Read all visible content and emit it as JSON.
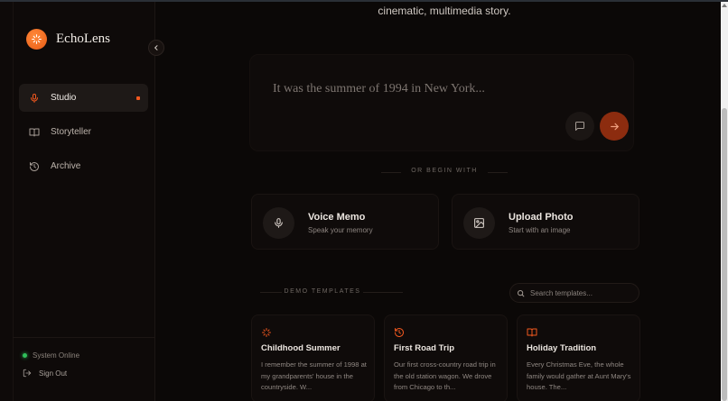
{
  "app": {
    "name": "EchoLens",
    "accent": "#f2581f"
  },
  "sidebar": {
    "items": [
      {
        "label": "Studio",
        "icon": "mic-icon",
        "active": true
      },
      {
        "label": "Storyteller",
        "icon": "book-icon",
        "active": false
      },
      {
        "label": "Archive",
        "icon": "history-icon",
        "active": false
      }
    ],
    "status": "System Online",
    "signout": "Sign Out"
  },
  "main": {
    "tagline": "cinematic, multimedia story.",
    "prompt_placeholder": "It was the summer of 1994 in New York...",
    "begin_label": "OR BEGIN WITH",
    "actions": [
      {
        "title": "Voice Memo",
        "subtitle": "Speak your memory",
        "icon": "mic-icon"
      },
      {
        "title": "Upload Photo",
        "subtitle": "Start with an image",
        "icon": "image-icon"
      }
    ],
    "demo_label": "DEMO TEMPLATES",
    "search_placeholder": "Search templates...",
    "templates": [
      {
        "title": "Childhood Summer",
        "icon": "sparkles-icon",
        "body": "I remember the summer of 1998 at my grandparents' house in the countryside. W..."
      },
      {
        "title": "First Road Trip",
        "icon": "history-icon",
        "body": "Our first cross-country road trip in the old station wagon. We drove from Chicago to th..."
      },
      {
        "title": "Holiday Tradition",
        "icon": "book-icon",
        "body": "Every Christmas Eve, the whole family would gather at Aunt Mary's house. The..."
      }
    ]
  }
}
